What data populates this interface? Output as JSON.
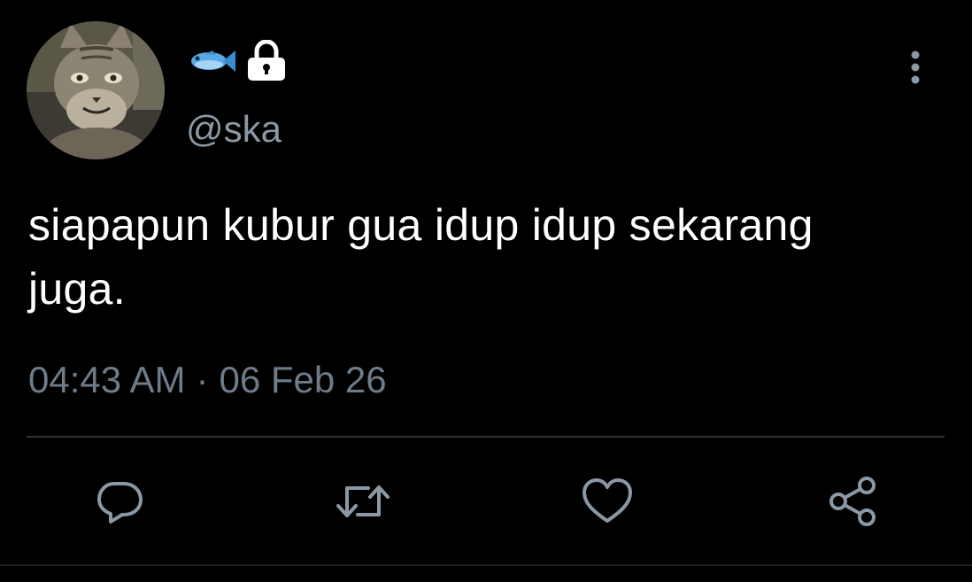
{
  "tweet": {
    "avatar": {
      "icon": "cat-avatar"
    },
    "display_name_icons": [
      "fish-icon",
      "lock-icon"
    ],
    "handle": "@ska",
    "text": "siapapun kubur gua idup idup sekarang juga.",
    "time": "04:43 AM",
    "separator": "·",
    "date": "06 Feb 26"
  },
  "actions": [
    "reply-icon",
    "retweet-icon",
    "like-icon",
    "share-icon"
  ],
  "colors": {
    "background": "#000000",
    "text": "#ffffff",
    "secondary_text": "#8b98a5",
    "icon": "#8b98a5",
    "divider": "#2f3336",
    "fish": "#5aa9e6"
  }
}
